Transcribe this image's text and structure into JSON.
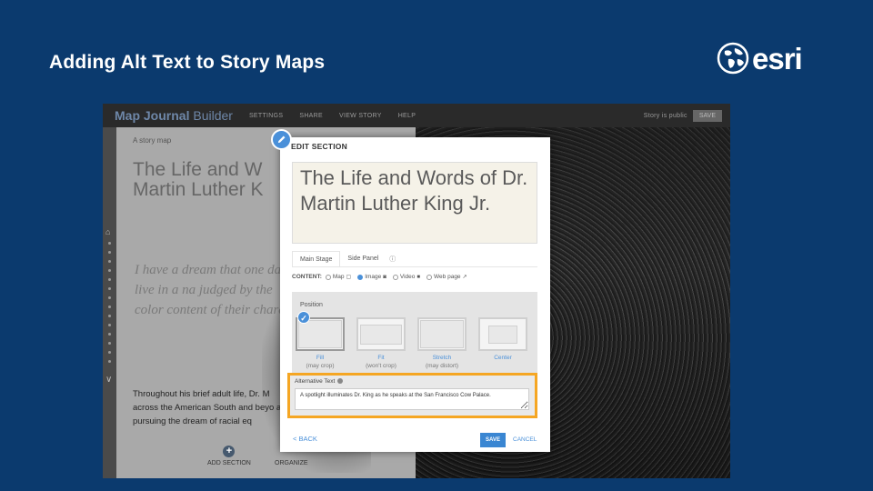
{
  "slide": {
    "title": "Adding Alt Text to Story Maps",
    "logo_text": "esri"
  },
  "builder": {
    "app_title_1": "Map Journal",
    "app_title_2": "Builder",
    "menu": [
      "SETTINGS",
      "SHARE",
      "VIEW STORY",
      "HELP"
    ],
    "status": "Story is public",
    "save_label": "SAVE"
  },
  "story": {
    "label": "A story map",
    "heading": "The Life and Words of Martin Luther King",
    "heading_visible": "The Life and W\nMartin Luther K",
    "quote": "I have a dream that one day live in a na judged by the color content of their chara",
    "body": "Throughout his brief adult life, Dr. M across the American South and beyo and pursuing the dream of racial eq",
    "add_section": "ADD SECTION",
    "organize": "ORGANIZE"
  },
  "modal": {
    "title": "EDIT SECTION",
    "section_title": "The Life and Words of Dr. Martin Luther King Jr.",
    "tabs": [
      "Main Stage",
      "Side Panel"
    ],
    "content_label": "CONTENT:",
    "content_options": [
      {
        "label": "Map",
        "icon": "map-icon",
        "selected": false
      },
      {
        "label": "Image",
        "icon": "camera-icon",
        "selected": true
      },
      {
        "label": "Video",
        "icon": "video-icon",
        "selected": false
      },
      {
        "label": "Web page",
        "icon": "external-link-icon",
        "selected": false
      }
    ],
    "position_label": "Position",
    "positions": [
      {
        "label": "Fill",
        "sub": "(may crop)"
      },
      {
        "label": "Fit",
        "sub": "(won't crop)"
      },
      {
        "label": "Stretch",
        "sub": "(may distort)"
      },
      {
        "label": "Center",
        "sub": ""
      }
    ],
    "alt_label": "Alternative Text",
    "alt_value": "A spotlight illuminates Dr. King as he speaks at the San Francisco Cow Palace.",
    "back_label": "< BACK",
    "save_label": "SAVE",
    "cancel_label": "CANCEL"
  },
  "colors": {
    "slide_bg": "#0b3a6e",
    "accent": "#4a90d9",
    "highlight": "#f5a623"
  }
}
